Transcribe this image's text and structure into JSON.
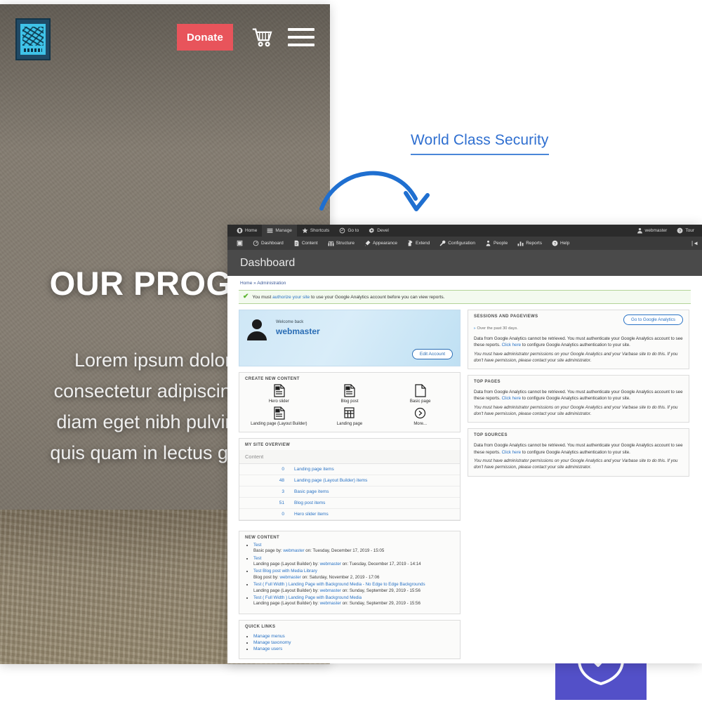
{
  "callout": {
    "title": "World Class Security",
    "title_color": "#2f6fd0",
    "arrow_color": "#1f6fd0"
  },
  "badge": {
    "icon": "shield-check-icon",
    "background": "#5350c8"
  },
  "site": {
    "logo_alt": "organization-logo",
    "donate_label": "Donate",
    "cart_icon": "shopping-cart-icon",
    "menu_icon": "hamburger-menu-icon",
    "hero_title": "OUR PROGRA",
    "hero_lines": [
      "Lorem ipsum dolor sit",
      "consectetur adipiscing elit.",
      "diam eget nibh pulvinar tri",
      "quis quam in lectus gravida"
    ]
  },
  "admin": {
    "toolbar": {
      "primary": [
        {
          "label": "Home",
          "icon": "home-icon",
          "active": false
        },
        {
          "label": "Manage",
          "icon": "manage-icon",
          "active": true
        },
        {
          "label": "Shortcuts",
          "icon": "star-icon",
          "active": false
        },
        {
          "label": "Go to",
          "icon": "goto-icon",
          "active": false
        },
        {
          "label": "Devel",
          "icon": "gear-icon",
          "active": false
        }
      ],
      "account": {
        "label": "webmaster",
        "icon": "user-icon"
      },
      "tour": {
        "label": "Tour",
        "icon": "question-mark-icon"
      },
      "secondary": [
        {
          "label": "Dashboard",
          "icon": "dashboard-icon"
        },
        {
          "label": "Content",
          "icon": "content-file-icon"
        },
        {
          "label": "Structure",
          "icon": "structure-icon"
        },
        {
          "label": "Appearance",
          "icon": "appearance-brush-icon"
        },
        {
          "label": "Extend",
          "icon": "extend-puzzle-icon"
        },
        {
          "label": "Configuration",
          "icon": "configuration-wrench-icon"
        },
        {
          "label": "People",
          "icon": "people-icon"
        },
        {
          "label": "Reports",
          "icon": "reports-chart-icon"
        },
        {
          "label": "Help",
          "icon": "help-icon"
        }
      ],
      "orientation_toggle_icon": "toolbar-orientation-icon"
    },
    "page_title": "Dashboard",
    "breadcrumb": "Home » Administration",
    "status_message": {
      "icon": "check-icon",
      "prefix": "You must ",
      "link": "authorize your site",
      "suffix": " to use your Google Analytics account before you can view reports."
    },
    "welcome": {
      "greeting": "Welcome back",
      "username": "webmaster",
      "edit_button": "Edit Account",
      "avatar_icon": "user-avatar-icon"
    },
    "create_content": {
      "heading": "CREATE NEW CONTENT",
      "items": [
        {
          "label": "Hero slider",
          "icon": "node-type-icon"
        },
        {
          "label": "Blog post",
          "icon": "node-type-icon"
        },
        {
          "label": "Basic page",
          "icon": "page-icon"
        },
        {
          "label": "Landing page (Layout Builder)",
          "icon": "node-type-icon"
        },
        {
          "label": "Landing page",
          "icon": "grid-icon"
        },
        {
          "label": "More...",
          "icon": "chevron-right-circle-icon"
        }
      ]
    },
    "site_overview": {
      "heading": "MY SITE OVERVIEW",
      "column_header": "Content",
      "rows": [
        {
          "count": "0",
          "label": "Landing page items"
        },
        {
          "count": "48",
          "label": "Landing page (Layout Builder) items"
        },
        {
          "count": "3",
          "label": "Basic page items"
        },
        {
          "count": "51",
          "label": "Blog post items"
        },
        {
          "count": "0",
          "label": "Hero slider items"
        }
      ]
    },
    "new_content": {
      "heading": "NEW CONTENT",
      "items": [
        {
          "title": "Test",
          "meta_prefix": "Basic page by: ",
          "author": "webmaster",
          "meta_suffix": " on: Tuesday, December 17, 2019 - 15:05"
        },
        {
          "title": "Test",
          "meta_prefix": "Landing page (Layout Builder) by: ",
          "author": "webmaster",
          "meta_suffix": " on: Tuesday, December 17, 2019 - 14:14"
        },
        {
          "title": "Test Blog post with Media Library",
          "meta_prefix": "Blog post by: ",
          "author": "webmaster",
          "meta_suffix": " on: Saturday, November 2, 2019 - 17:06"
        },
        {
          "title": "Test ( Full Width ) Landing Page with Background Media - No Edge to Edge Backgrounds",
          "meta_prefix": "Landing page (Layout Builder) by: ",
          "author": "webmaster",
          "meta_suffix": " on: Sunday, September 29, 2019 - 15:56"
        },
        {
          "title": "Test ( Full Width ) Landing Page with Background Media",
          "meta_prefix": "Landing page (Layout Builder) by: ",
          "author": "webmaster",
          "meta_suffix": " on: Sunday, September 29, 2019 - 15:56"
        }
      ]
    },
    "quick_links": {
      "heading": "QUICK LINKS",
      "items": [
        "Manage menus",
        "Manage taxonomy",
        "Manage users"
      ]
    },
    "analytics": {
      "sessions": {
        "heading": "SESSIONS AND PAGEVIEWS",
        "button": "Go to Google Analytics",
        "subtitle": "Over the past 30 days.",
        "body_a1": "Data from Google Analytics cannot be retrieved. You must authenticate your Google Analytics account to see these reports. ",
        "body_link": "Click here",
        "body_a2": " to configure Google Analytics authentication to your site.",
        "body_b": "You must have administrator permissions on your Google Analytics and your Varbase site to do this. If you don't have permission, please contact your site administrator."
      },
      "top_pages": {
        "heading": "TOP PAGES",
        "body_a1": "Data from Google Analytics cannot be retrieved. You must authenticate your Google Analytics account to see these reports. ",
        "body_link": "Click here",
        "body_a2": " to configure Google Analytics authentication to your site.",
        "body_b": "You must have administrator permissions on your Google Analytics and your Varbase site to do this. If you don't have permission, please contact your site administrator."
      },
      "top_sources": {
        "heading": "TOP SOURCES",
        "body_a1": "Data from Google Analytics cannot be retrieved. You must authenticate your Google Analytics account to see these reports. ",
        "body_link": "Click here",
        "body_a2": " to configure Google Analytics authentication to your site.",
        "body_b": "You must have administrator permissions on your Google Analytics and your Varbase site to do this. If you don't have permission, please contact your site administrator."
      }
    }
  }
}
